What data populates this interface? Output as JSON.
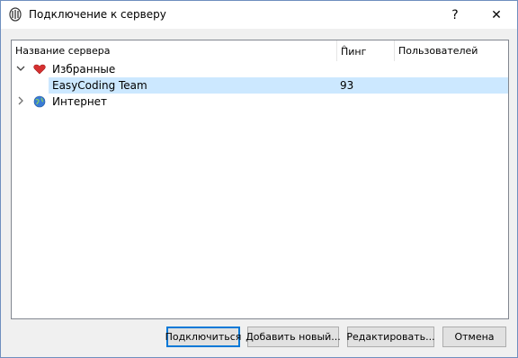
{
  "window": {
    "title": "Подключение к серверу",
    "help": "?",
    "close": "✕"
  },
  "tree": {
    "columns": {
      "name": "Название сервера",
      "ping": "Пинг",
      "users": "Пользователей"
    },
    "sort_indicator": "^",
    "groups": [
      {
        "label": "Избранные",
        "expanded": true,
        "icon": "heart-icon"
      },
      {
        "label": "Интернет",
        "expanded": false,
        "icon": "globe-icon"
      }
    ],
    "servers": [
      {
        "name": "EasyCoding Team",
        "ping": "93",
        "users": "",
        "selected": true
      }
    ]
  },
  "buttons": {
    "connect": "Подключиться",
    "add": "Добавить новый...",
    "edit": "Редактировать...",
    "cancel": "Отмена"
  },
  "colors": {
    "selection": "#cce8ff",
    "default_button_border": "#0078d7"
  }
}
